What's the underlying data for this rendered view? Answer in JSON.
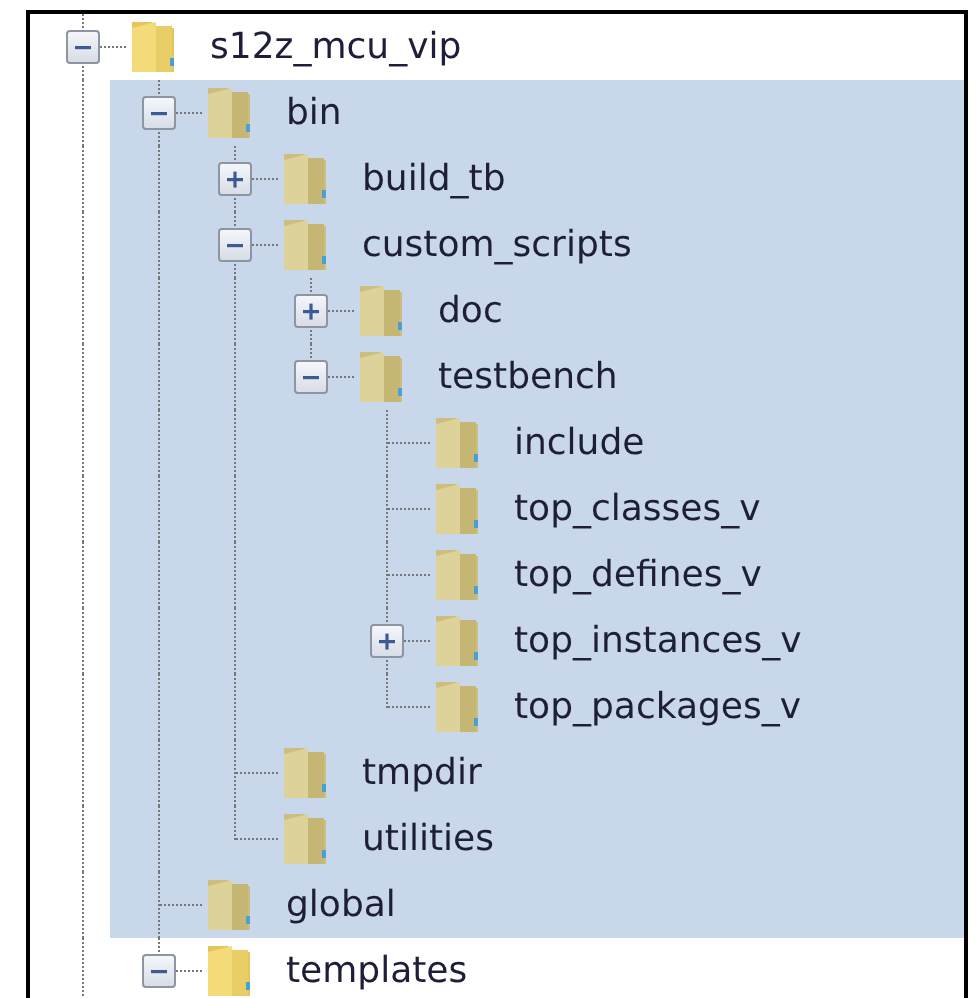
{
  "tree": [
    {
      "label": "s12z_mcu_vip",
      "expanded": true,
      "selected": false,
      "children": [
        {
          "label": "bin",
          "expanded": true,
          "selected": true,
          "children": [
            {
              "label": "build_tb",
              "expanded": false,
              "selected": true
            },
            {
              "label": "custom_scripts",
              "expanded": true,
              "selected": true,
              "children": [
                {
                  "label": "doc",
                  "expanded": false,
                  "selected": true
                },
                {
                  "label": "testbench",
                  "expanded": true,
                  "selected": true,
                  "children": [
                    {
                      "label": "include",
                      "selected": true
                    },
                    {
                      "label": "top_classes_v",
                      "selected": true
                    },
                    {
                      "label": "top_defines_v",
                      "selected": true
                    },
                    {
                      "label": "top_instances_v",
                      "expanded": false,
                      "selected": true
                    },
                    {
                      "label": "top_packages_v",
                      "selected": true
                    }
                  ]
                }
              ]
            },
            {
              "label": "tmpdir",
              "selected": true
            },
            {
              "label": "utilities",
              "selected": true
            }
          ]
        },
        {
          "label": "global",
          "selected": true
        },
        {
          "label": "templates",
          "expanded": true,
          "selected": false
        }
      ]
    }
  ]
}
